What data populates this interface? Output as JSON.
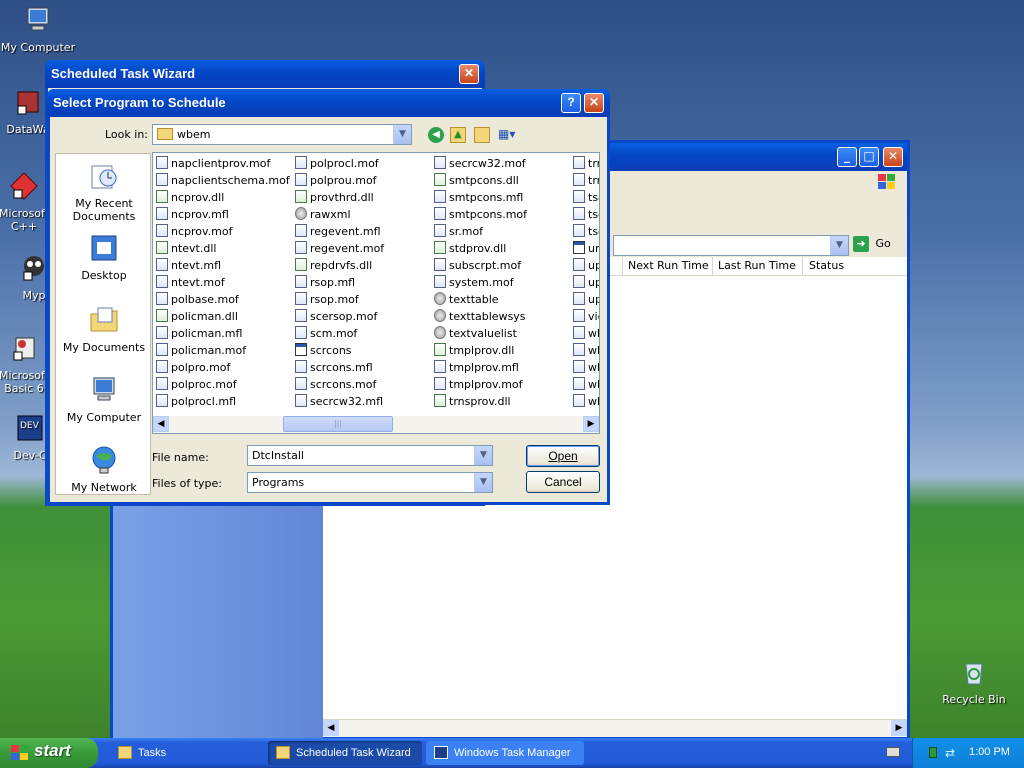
{
  "desktop": {
    "icons": [
      {
        "label": "My Computer"
      },
      {
        "label": "DataWa"
      },
      {
        "label": "Microsoft C++"
      },
      {
        "label": "Myp"
      },
      {
        "label": "Microsoft Basic 6"
      },
      {
        "label": "Dev-C"
      },
      {
        "label": "Recycle Bin"
      }
    ]
  },
  "wizard": {
    "title": "Scheduled Task Wizard"
  },
  "task_manager": {
    "go_label": "Go",
    "columns": [
      "Next Run Time",
      "Last Run Time",
      "Status"
    ]
  },
  "dialog": {
    "title": "Select Program to Schedule",
    "look_in_label": "Look in:",
    "look_in_value": "wbem",
    "places": [
      "My Recent Documents",
      "Desktop",
      "My Documents",
      "My Computer",
      "My Network"
    ],
    "file_columns": [
      [
        "napclientprov.mof",
        "napclientschema.mof",
        "ncprov.dll",
        "ncprov.mfl",
        "ncprov.mof",
        "ntevt.dll",
        "ntevt.mfl",
        "ntevt.mof",
        "polbase.mof",
        "policman.dll",
        "policman.mfl",
        "policman.mof",
        "polpro.mof",
        "polproc.mof",
        "polprocl.mfl"
      ],
      [
        "polprocl.mof",
        "polprou.mof",
        "provthrd.dll",
        "rawxml",
        "regevent.mfl",
        "regevent.mof",
        "repdrvfs.dll",
        "rsop.mfl",
        "rsop.mof",
        "scersop.mof",
        "scm.mof",
        "scrcons",
        "scrcons.mfl",
        "scrcons.mof",
        "secrcw32.mfl"
      ],
      [
        "secrcw32.mof",
        "smtpcons.dll",
        "smtpcons.mfl",
        "smtpcons.mof",
        "sr.mof",
        "stdprov.dll",
        "subscrpt.mof",
        "system.mof",
        "texttable",
        "texttablewsys",
        "textvaluelist",
        "tmplprov.dll",
        "tmplprov.mfl",
        "tmplprov.mof",
        "trnsprov.dll"
      ],
      [
        "trn",
        "trr",
        "tsa",
        "tsc",
        "tsc",
        "un",
        "up",
        "up",
        "up",
        "vie",
        "wb",
        "wb",
        "wb",
        "wb",
        "wb"
      ]
    ],
    "file_name_label": "File name:",
    "file_name_value": "DtcInstall",
    "file_type_label": "Files of type:",
    "file_type_value": "Programs",
    "open_label": "Open",
    "cancel_label": "Cancel"
  },
  "taskbar": {
    "start_label": "start",
    "items": [
      "Tasks",
      "Scheduled Task Wizard",
      "Windows Task Manager"
    ],
    "clock": "1:00 PM"
  }
}
